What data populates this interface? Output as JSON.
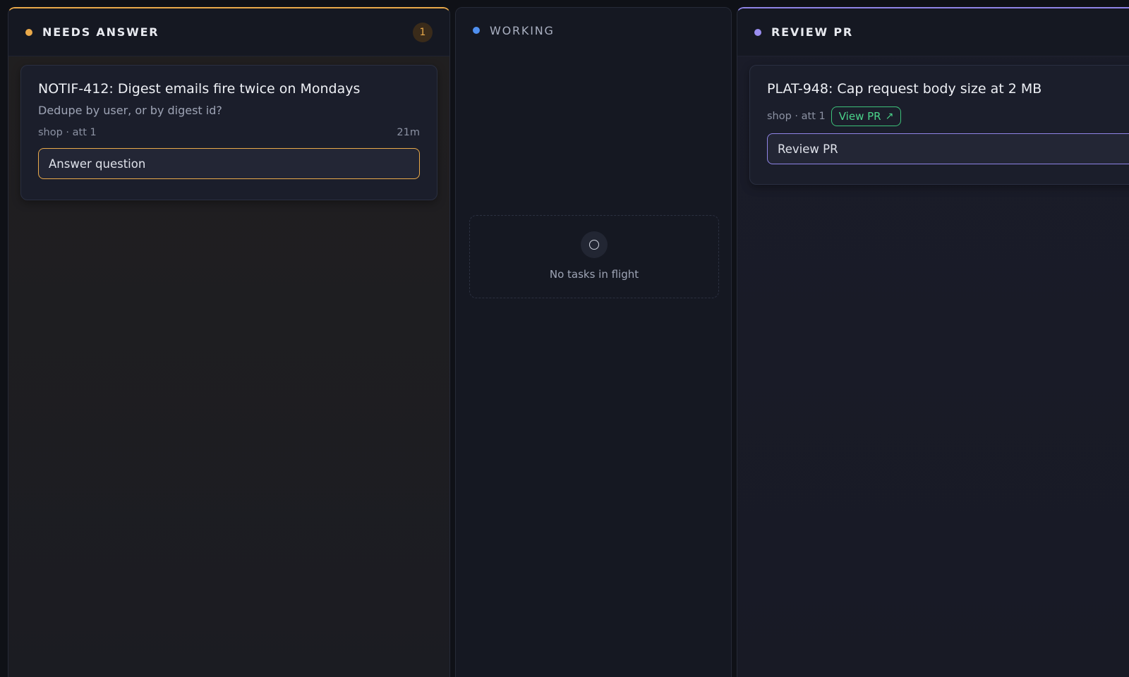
{
  "colors": {
    "needs_answer_accent": "#e9a94a",
    "working_accent": "#4f8ff0",
    "review_accent": "#9a8df0",
    "view_pr_green": "#4ad38a"
  },
  "columns": {
    "needs_answer": {
      "title": "NEEDS ANSWER",
      "count": "1",
      "cards": [
        {
          "title": "NOTIF-412: Digest emails fire twice on Mondays",
          "subtitle": "Dedupe by user, or by digest id?",
          "meta": "shop · att 1",
          "age": "21m",
          "action_label": "Answer question"
        }
      ]
    },
    "working": {
      "title": "WORKING",
      "empty_icon": "circle-icon",
      "empty_text": "No tasks in flight"
    },
    "review_pr": {
      "title": "REVIEW PR",
      "cards": [
        {
          "title": "PLAT-948: Cap request body size at 2 MB",
          "meta": "shop · att 1",
          "pr_link_label": "View PR",
          "pr_link_icon": "external-arrow-icon",
          "action_label": "Review PR"
        }
      ]
    }
  }
}
